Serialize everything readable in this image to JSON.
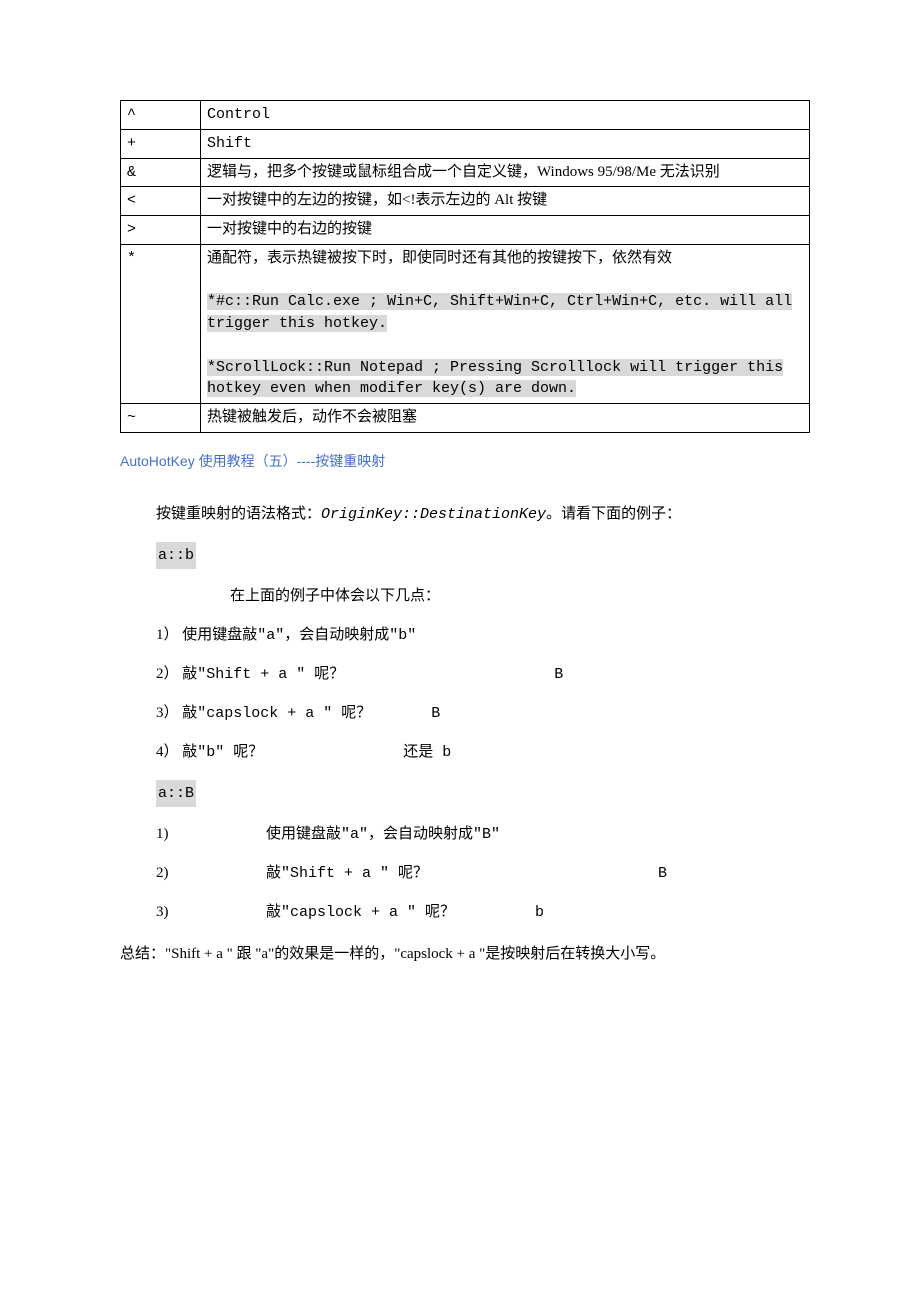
{
  "table": {
    "rows": [
      {
        "sym": "^",
        "desc": "Control"
      },
      {
        "sym": "+",
        "desc": "Shift"
      },
      {
        "sym": "&",
        "desc": "逻辑与，把多个按键或鼠标组合成一个自定义键，Windows 95/98/Me 无法识别"
      },
      {
        "sym": "<",
        "desc": "一对按键中的左边的按键，如<!表示左边的 Alt 按键"
      },
      {
        "sym": ">",
        "desc": "一对按键中的右边的按键"
      },
      {
        "sym": "*",
        "desc_top": "通配符，表示热键被按下时，即使同时还有其他的按键按下，依然有效",
        "code1": "*#c::Run Calc.exe ; Win+C, Shift+Win+C, Ctrl+Win+C, etc. will all trigger this hotkey.",
        "code2": "*ScrollLock::Run Notepad ; Pressing Scrolllock will trigger this hotkey even when modifer key(s) are down."
      },
      {
        "sym": "~",
        "desc": "热键被触发后，动作不会被阻塞"
      }
    ]
  },
  "section_title": "AutoHotKey 使用教程（五）----按键重映射",
  "intro": {
    "prefix": "按键重映射的语法格式：",
    "italic": "OriginKey::DestinationKey",
    "suffix": "。请看下面的例子："
  },
  "example1_code": "a::b",
  "example1_caption": "在上面的例子中体会以下几点：",
  "list1": [
    {
      "num": "1）",
      "text": "使用键盘敲\"a\"，会自动映射成\"b\""
    },
    {
      "num": "2）",
      "text": "敲\"Shift + a \" 呢？",
      "tail": "B",
      "gap": 210
    },
    {
      "num": "3）",
      "text": "敲\"capslock + a \" 呢？",
      "tail": "B",
      "gap": 60
    },
    {
      "num": "4）",
      "text": "敲\"b\" 呢？",
      "tail": "还是 b",
      "gap": 140
    }
  ],
  "example2_code": "a::B",
  "list2": [
    {
      "num": "1)",
      "text": "使用键盘敲\"a\"，会自动映射成\"B\""
    },
    {
      "num": "2)",
      "text": "敲\"Shift + a \" 呢？",
      "tail": "B",
      "gap": 230
    },
    {
      "num": "3)",
      "text": "敲\"capslock + a \" 呢？",
      "tail": "b",
      "gap": 80
    }
  ],
  "summary": "总结：\"Shift + a \" 跟 \"a\"的效果是一样的，\"capslock + a \"是按映射后在转换大小写。"
}
